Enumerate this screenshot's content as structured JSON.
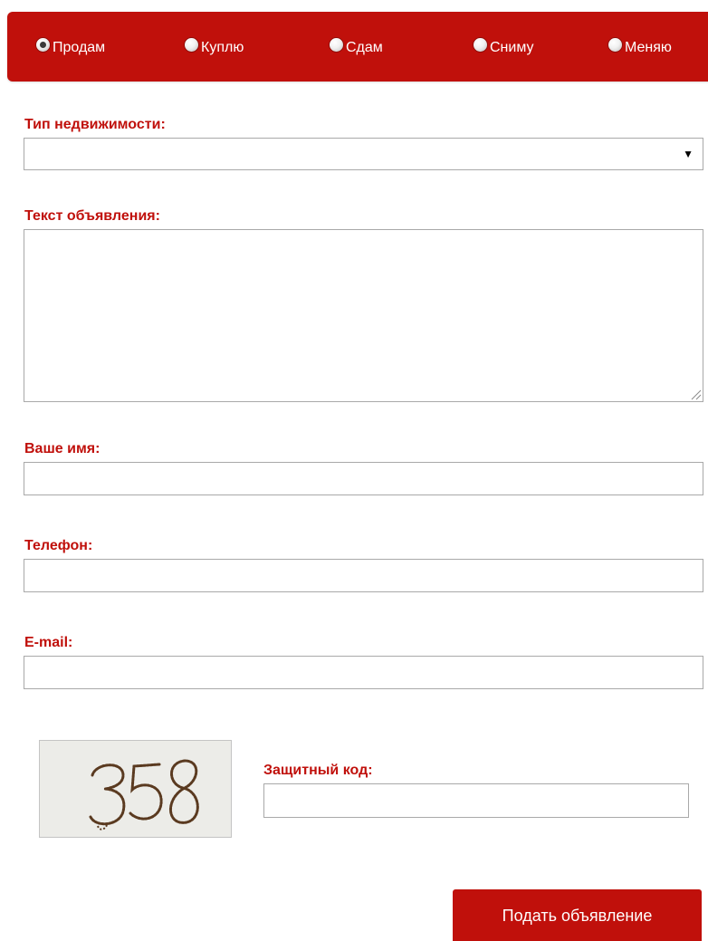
{
  "deal_types": [
    {
      "label": "Продам",
      "checked": true
    },
    {
      "label": "Куплю",
      "checked": false
    },
    {
      "label": "Сдам",
      "checked": false
    },
    {
      "label": "Сниму",
      "checked": false
    },
    {
      "label": "Меняю",
      "checked": false
    }
  ],
  "property_type": {
    "label": "Тип недвижимости:",
    "selected_value": ""
  },
  "ad_text": {
    "label": "Текст объявления:",
    "value": ""
  },
  "name": {
    "label": "Ваше имя:",
    "value": ""
  },
  "phone": {
    "label": "Телефон:",
    "value": ""
  },
  "email": {
    "label": "E-mail:",
    "value": ""
  },
  "captcha": {
    "label": "Защитный код:",
    "image_text": "358",
    "value": ""
  },
  "submit": {
    "label": "Подать объявление"
  },
  "colors": {
    "accent": "#c0100b",
    "input_border": "#a9a9a9",
    "captcha_bg": "#ecece8",
    "captcha_ink": "#5a3a20"
  }
}
